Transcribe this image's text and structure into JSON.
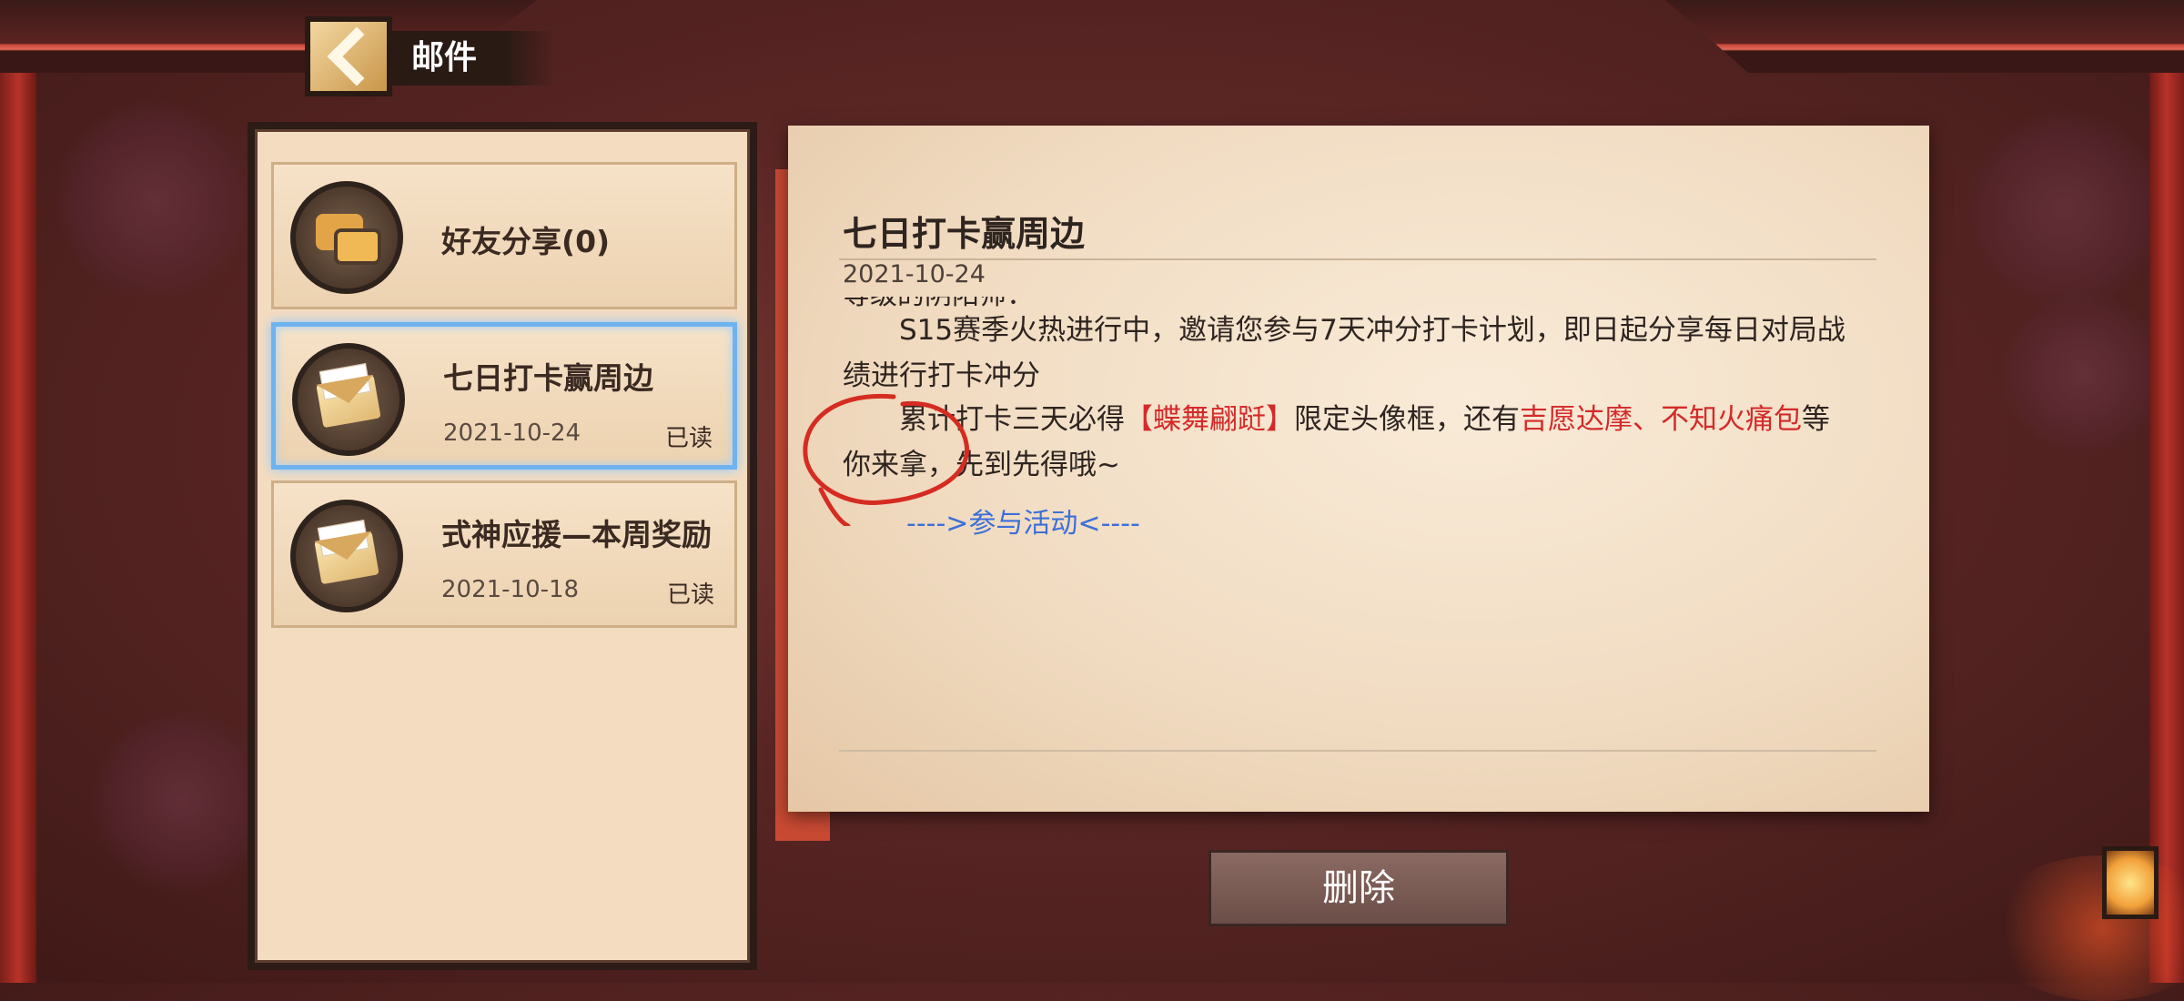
{
  "header": {
    "title": "邮件"
  },
  "mail_list": [
    {
      "title": "好友分享(0)",
      "date": "",
      "status": "",
      "icon": "chat-bubbles-icon"
    },
    {
      "title": "七日打卡赢周边",
      "date": "2021-10-24",
      "status": "已读",
      "icon": "envelope-icon",
      "selected": true
    },
    {
      "title": "式神应援—本周奖励",
      "date": "2021-10-18",
      "status": "已读",
      "icon": "envelope-icon"
    }
  ],
  "letter": {
    "title": "七日打卡赢周边",
    "date": "2021-10-24",
    "cut_line": "等级的阴阳师：",
    "para1": "S15赛季火热进行中，邀请您参与7天冲分打卡计划，即日起分享每日对局战绩进行打卡冲分",
    "para2_a": "累计打卡三天必得",
    "para2_red1": "【蝶舞翩跹】",
    "para2_b": "限定头像框，还有",
    "para2_red2": "吉愿达摩、不知火痛包",
    "para2_c": "等你来拿，先到先得哦~",
    "link": "---->参与活动<----"
  },
  "actions": {
    "delete": "删除"
  },
  "colors": {
    "highlight_red": "#d42a2a",
    "link_blue": "#3c6fd8",
    "selected_border": "#6fb3ee"
  }
}
